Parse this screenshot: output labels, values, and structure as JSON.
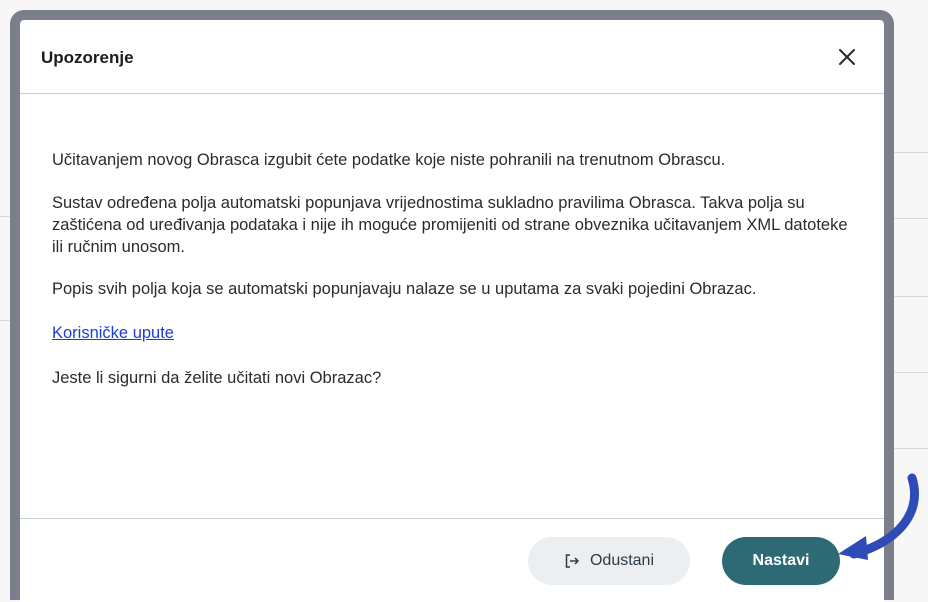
{
  "dialog": {
    "title": "Upozorenje",
    "close_icon": "close-icon",
    "paragraphs": [
      "Učitavanjem novog Obrasca izgubit ćete podatke koje niste pohranili na trenutnom Obrascu.",
      "Sustav određena polja automatski popunjava vrijednostima sukladno pravilima Obrasca. Takva polja su zaštićena od uređivanja podataka i nije ih moguće promijeniti od strane obveznika učitavanjem XML datoteke ili ručnim unosom.",
      "Popis svih polja koja se automatski popunjavaju nalaze se u uputama za svaki pojedini Obrazac."
    ],
    "link_label": "Korisničke upute",
    "question": "Jeste li sigurni da želite učitati novi Obrazac?",
    "cancel_label": "Odustani",
    "cancel_icon": "sign-out-icon",
    "continue_label": "Nastavi"
  },
  "annotation": {
    "arrow_icon": "curved-arrow-icon",
    "color": "#2f4bb8"
  },
  "colors": {
    "primary_button": "#2d6a76",
    "secondary_button": "#eceff2",
    "link": "#1a3fd8",
    "frame": "#7b7f8c"
  }
}
